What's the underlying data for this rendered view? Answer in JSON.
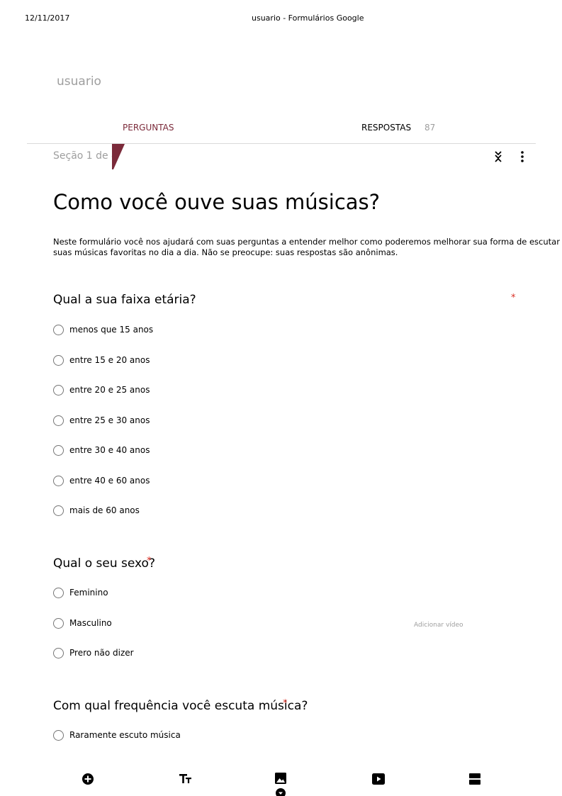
{
  "print_header": {
    "date": "12/11/2017",
    "title": "usuario - Formulários Google"
  },
  "form": {
    "name": "usuario"
  },
  "tabs": {
    "questions": "PERGUNTAS",
    "responses": "RESPOSTAS",
    "responses_count": "87"
  },
  "section": {
    "label": "Seção 1 de 4"
  },
  "main": {
    "title": "Como você ouve suas músicas?",
    "description": "Neste formulário você nos ajudará com suas perguntas a entender melhor como poderemos melhorar sua forma de escutar suas músicas favoritas no dia a dia. Não se preocupe: suas respostas são anônimas."
  },
  "questions": [
    {
      "title": "Qual a sua faixa etária?",
      "required_mark": "*",
      "options": [
        "menos que 15 anos",
        "entre 15 e 20 anos",
        "entre 20 e 25 anos",
        "entre 25 e 30 anos",
        "entre 30 e 40 anos",
        "entre 40 e 60 anos",
        "mais de 60 anos"
      ]
    },
    {
      "title": "Qual o seu sexo?",
      "required_mark": "*",
      "options": [
        "Feminino",
        "Masculino",
        "Prero não dizer"
      ]
    },
    {
      "title": "Com qual frequência você escuta música?",
      "required_mark": "*",
      "options": [
        "Raramente escuto música"
      ]
    }
  ],
  "floating": {
    "add_video": "Adicionar vídeo"
  },
  "colors": {
    "accent": "#7b2a3a",
    "required": "#d93025",
    "muted": "#9e9e9e"
  },
  "icons": {
    "toolbar": [
      "add-circle-icon",
      "text-title-icon",
      "image-icon",
      "video-icon",
      "section-icon"
    ],
    "header": [
      "collapse-icon",
      "more-vert-icon"
    ]
  }
}
